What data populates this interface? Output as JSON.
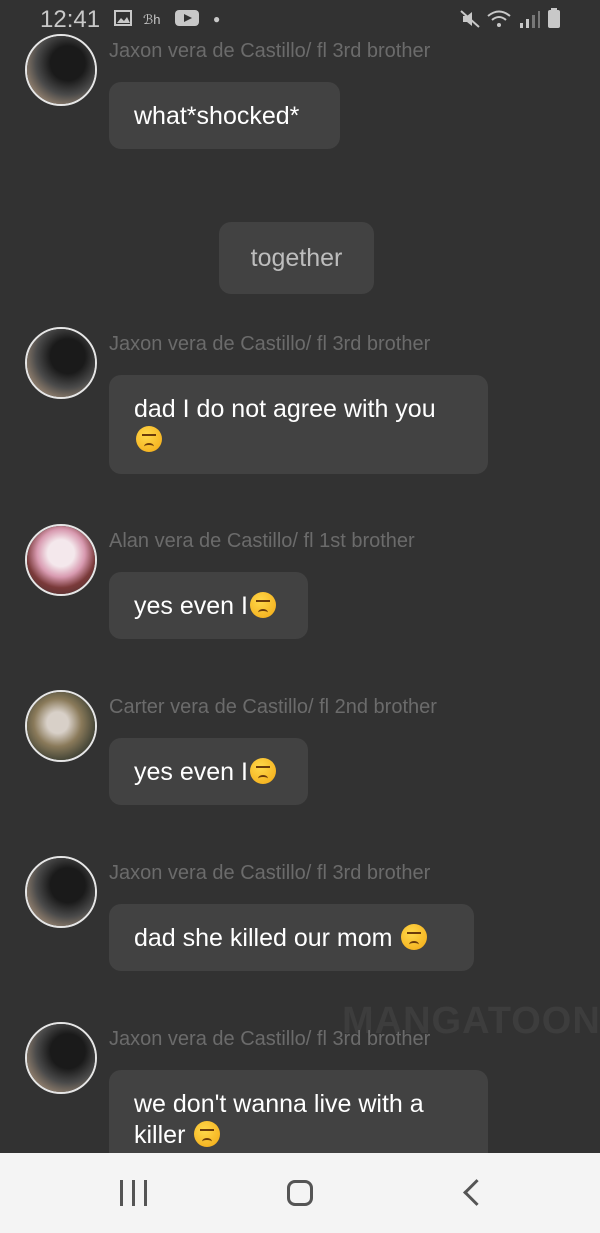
{
  "status_bar": {
    "time": "12:41",
    "icons": [
      "image-icon",
      "translate-icon",
      "youtube-icon",
      "dot-icon",
      "mute-icon",
      "wifi-icon",
      "signal-icon",
      "battery-icon"
    ]
  },
  "chat": {
    "narration": "together",
    "messages": [
      {
        "sender": "Jaxon vera de Castillo/ fl 3rd brother",
        "text": "what*shocked*",
        "emoji": false,
        "avatar": "jaxon"
      },
      {
        "sender": "Jaxon vera de Castillo/ fl 3rd brother",
        "line1": "dad I do not agree with you",
        "emoji_line2": true,
        "avatar": "jaxon"
      },
      {
        "sender": "Alan vera de Castillo/ fl 1st brother",
        "text": "yes even I",
        "emoji": true,
        "avatar": "alan"
      },
      {
        "sender": "Carter vera de Castillo/ fl 2nd brother",
        "text": "yes even I",
        "emoji": true,
        "avatar": "carter"
      },
      {
        "sender": "Jaxon vera de Castillo/ fl 3rd brother",
        "text": "dad she killed our mom ",
        "emoji": true,
        "avatar": "jaxon"
      },
      {
        "sender": "Jaxon vera de Castillo/ fl 3rd brother",
        "line1": "we don't wanna live with a",
        "line2": "killer ",
        "emoji_line2": true,
        "avatar": "jaxon"
      }
    ],
    "watermark": "MANGATOON"
  },
  "nav_bar": {
    "recents": "recents-icon",
    "home": "home-icon",
    "back": "back-icon"
  },
  "colors": {
    "background": "#323232",
    "bubble": "#424242",
    "sender_text": "#6b6b6b",
    "nav_bg": "#f4f4f4"
  }
}
